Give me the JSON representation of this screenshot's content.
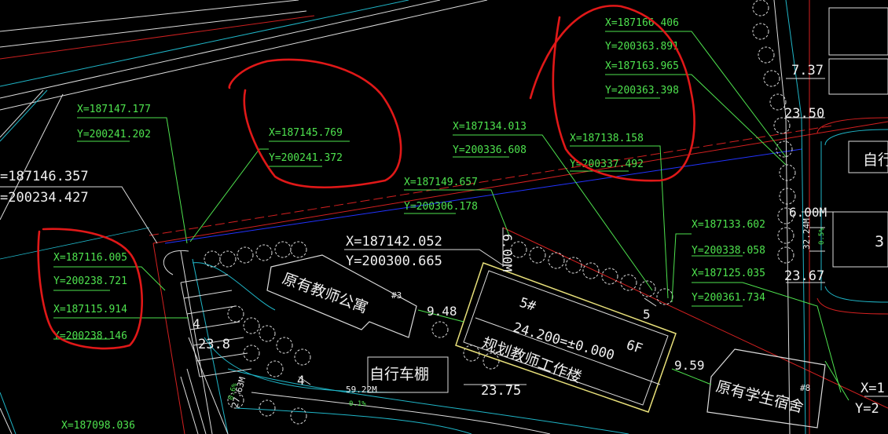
{
  "points": {
    "p1": {
      "x": "X=187147.177",
      "y": "Y=200241.202"
    },
    "p2": {
      "x": "X=187145.769",
      "y": "Y=200241.372"
    },
    "p3": {
      "x": "X=187134.013",
      "y": "Y=200336.608"
    },
    "p4": {
      "x": "X=187166.406",
      "y": "Y=200363.891"
    },
    "p5": {
      "x": "X=187163.965",
      "y": "Y=200363.398"
    },
    "p6": {
      "x": "X=187138.158",
      "y": "Y=200337.492"
    },
    "p7": {
      "x": "X=187149.657",
      "y": "Y=200306.178"
    },
    "p8": {
      "x": "X=187116.005",
      "y": "Y=200238.721"
    },
    "p9": {
      "x": "X=187115.914",
      "y": "Y=200238.146"
    },
    "p10": {
      "x": "X=187133.602",
      "y": "Y=200338.058"
    },
    "p11": {
      "x": "X=187125.035",
      "y": "Y=200361.734"
    },
    "bottom": "X=187098.036"
  },
  "big_coords": {
    "a": {
      "x": "=187146.357",
      "y": "=200234.427"
    },
    "b": {
      "x": "X=187142.052",
      "y": "Y=200300.665"
    },
    "c": {
      "x": "X=1",
      "y": "Y=2"
    }
  },
  "dims": {
    "d948": "9.48",
    "d959": "9.59",
    "d600m": "6.00M",
    "d600": "6.00M",
    "d3224": "32.24M",
    "d05": "0.5%",
    "d5922": "59.22M",
    "d01": "0.1%",
    "d2763": "27.63M",
    "d06": "0.6%",
    "d4a": "4",
    "d4b": "4",
    "d5": "5"
  },
  "elevations": {
    "e2375": "23.75",
    "e238": "23.8",
    "e2367": "23.67",
    "e2350": "23.50",
    "e737": "7.37",
    "e24": "24.200=±0.000"
  },
  "buildings": {
    "teacher_apt": "原有教师公寓",
    "teacher_apt_mark": "#3",
    "bike_shed": "自行车棚",
    "bldg5_no": "5#",
    "bldg5_name": "规划教师工作楼",
    "bldg5_floors": "6F",
    "dorm": "原有学生宿舍",
    "dorm_mark": "#8",
    "bike_right": "自行",
    "right_3": "3"
  },
  "colors": {
    "background": "#000000",
    "coordinate_text": "#4ee24e",
    "annotation_circle": "#e01818",
    "boundary_red": "#d42020",
    "road_cyan": "#1fb6c8",
    "blue_line": "#2233ff",
    "building_yellow": "#e8e07a"
  }
}
